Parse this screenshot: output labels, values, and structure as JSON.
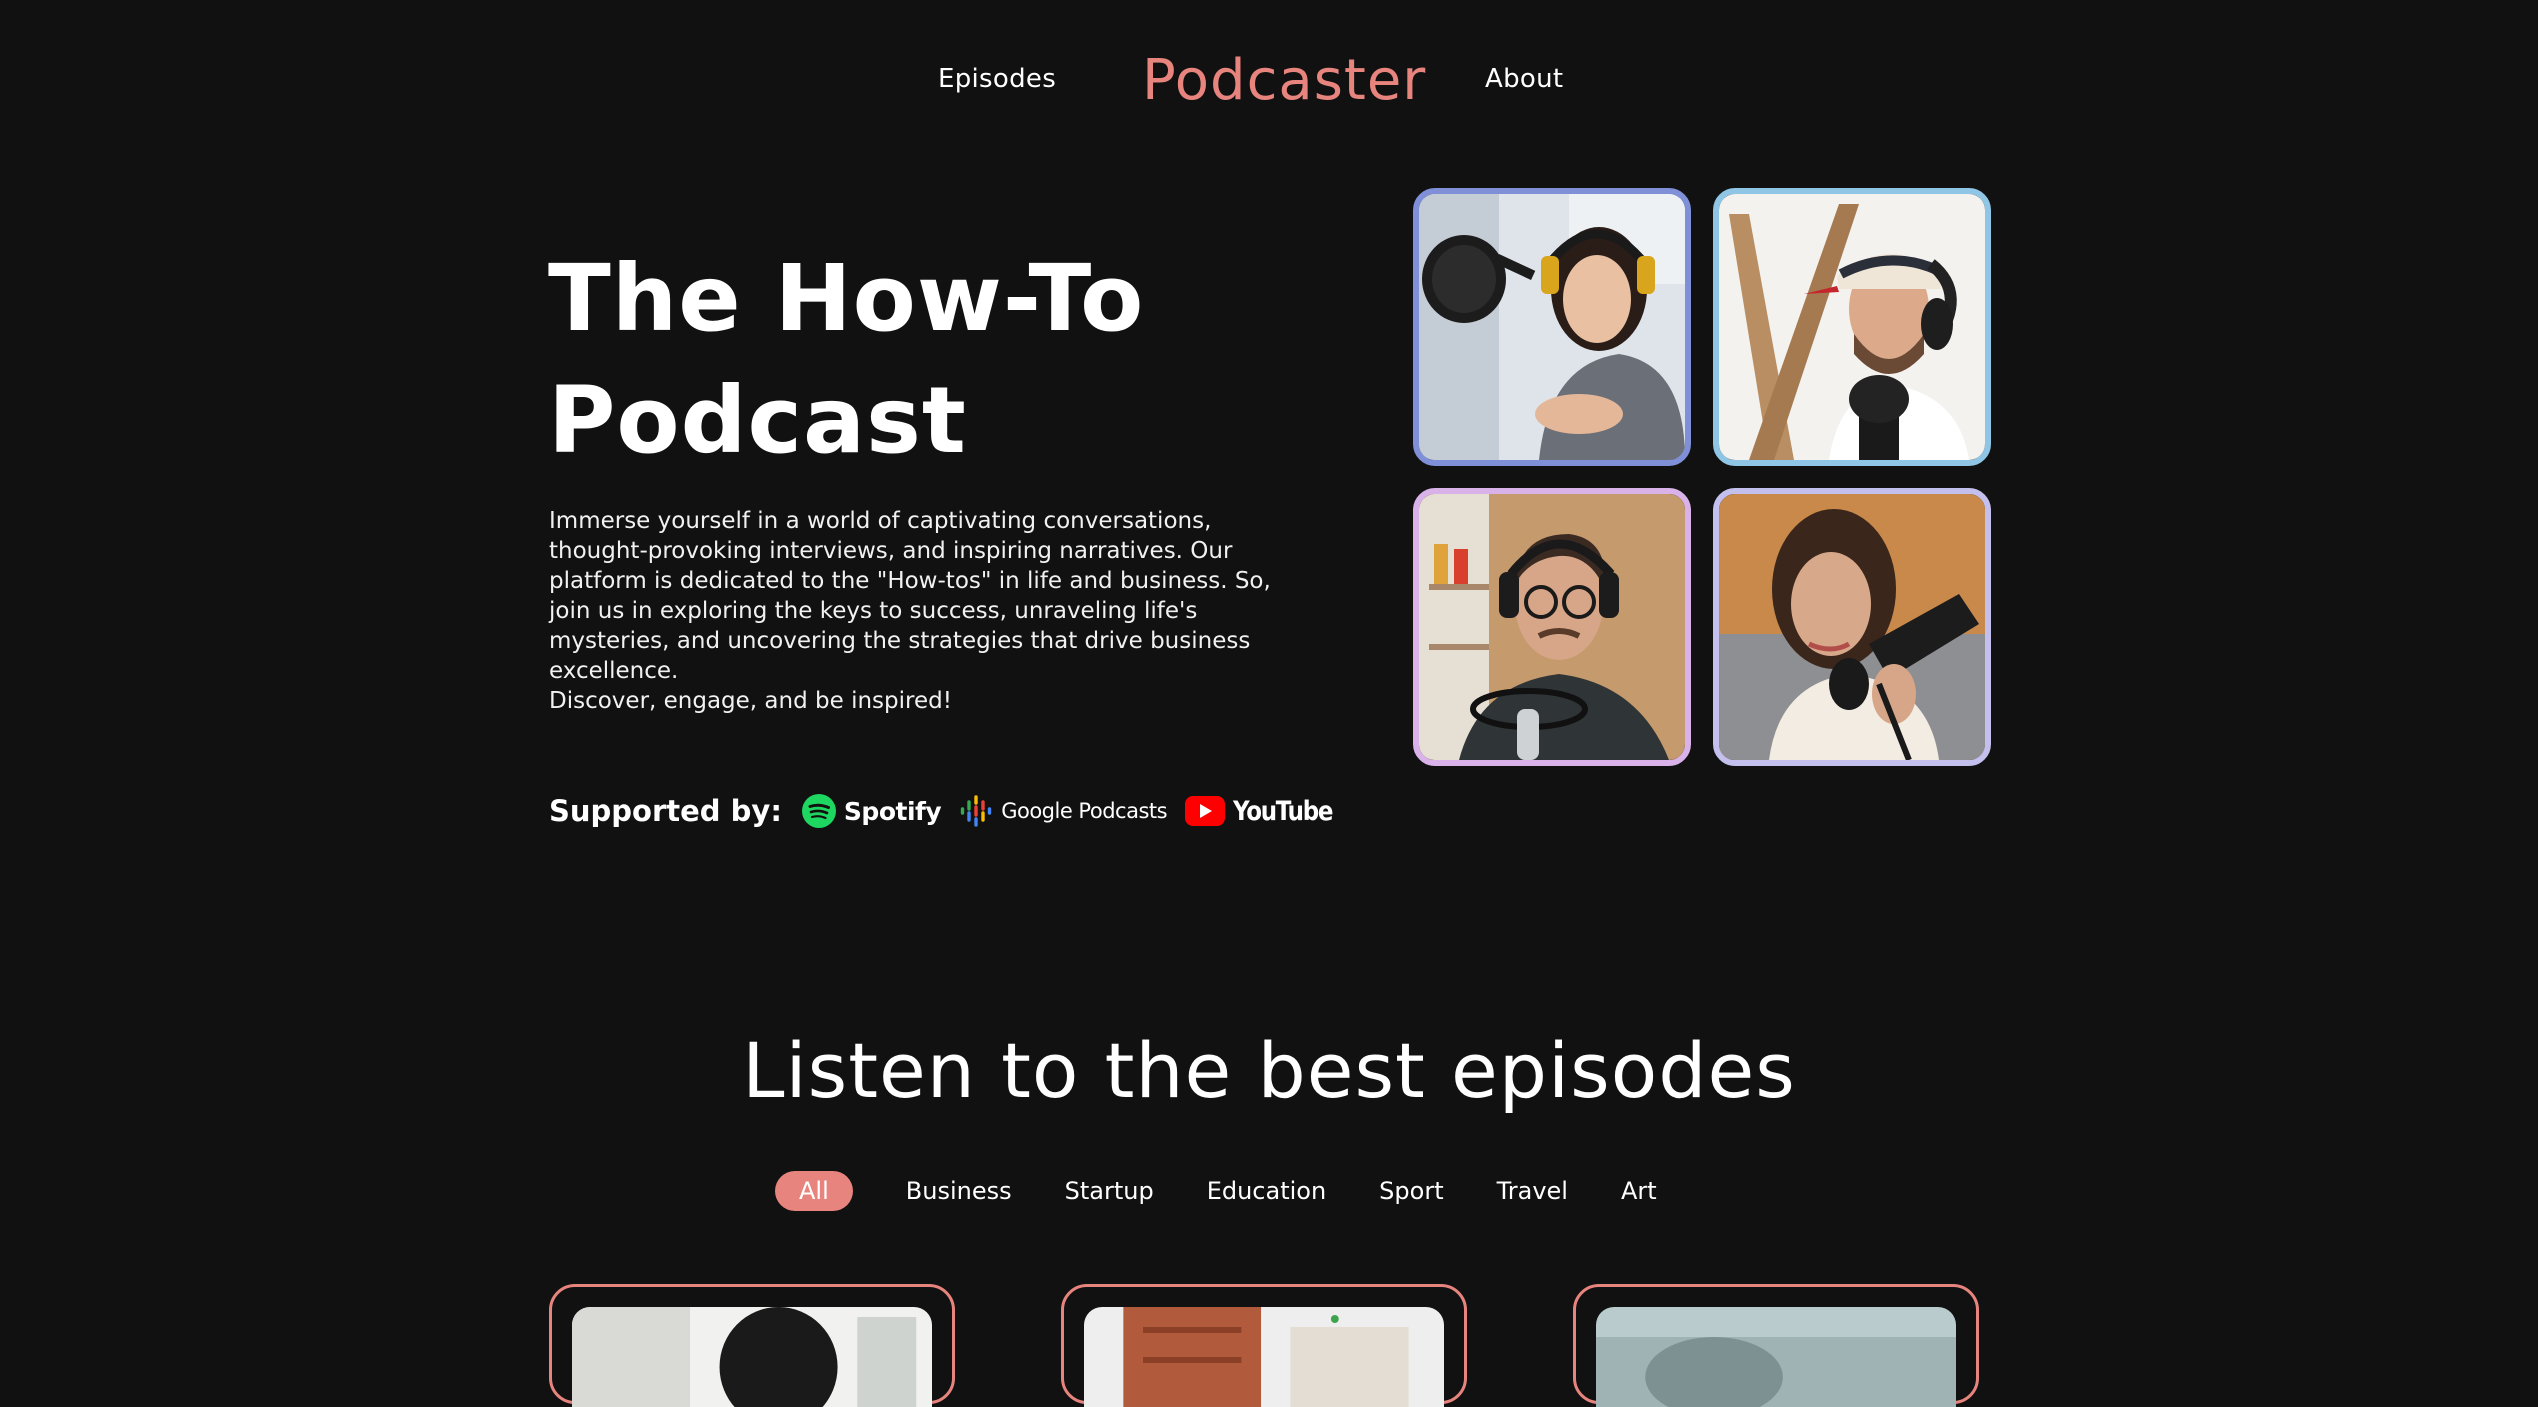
{
  "nav": {
    "episodes_label": "Episodes",
    "brand": "Podcaster",
    "about_label": "About"
  },
  "hero": {
    "title_line1": "The How-To",
    "title_line2": "Podcast",
    "description": "Immerse yourself in a world of captivating conversations, thought-provoking interviews, and inspiring narratives. Our platform is dedicated to the \"How-tos\" in life and business. So, join us in exploring the keys to success, unraveling life's mysteries, and uncovering the strategies that drive business excellence.",
    "tagline": "Discover, engage, and be inspired!",
    "supported_label": "Supported by:",
    "partners": [
      {
        "name": "Spotify",
        "icon": "spotify-icon",
        "color": "#1ed760"
      },
      {
        "name": "Google Podcasts",
        "icon": "google-podcasts-icon"
      },
      {
        "name": "YouTube",
        "icon": "youtube-icon",
        "color": "#ff0000"
      }
    ]
  },
  "photos": [
    {
      "alt": "woman-with-microphone-photo",
      "border": "#7f8fd8"
    },
    {
      "alt": "man-with-cap-photo",
      "border": "#8fc6e6"
    },
    {
      "alt": "man-with-glasses-photo",
      "border": "#d8b2e8"
    },
    {
      "alt": "woman-with-headphones-photo",
      "border": "#c4c0ee"
    }
  ],
  "episodes": {
    "title": "Listen to the best episodes",
    "filters": [
      "All",
      "Business",
      "Startup",
      "Education",
      "Sport",
      "Travel",
      "Art"
    ],
    "active_filter": "All"
  },
  "colors": {
    "background": "#111111",
    "accent": "#e8847e",
    "text": "#ffffff"
  }
}
